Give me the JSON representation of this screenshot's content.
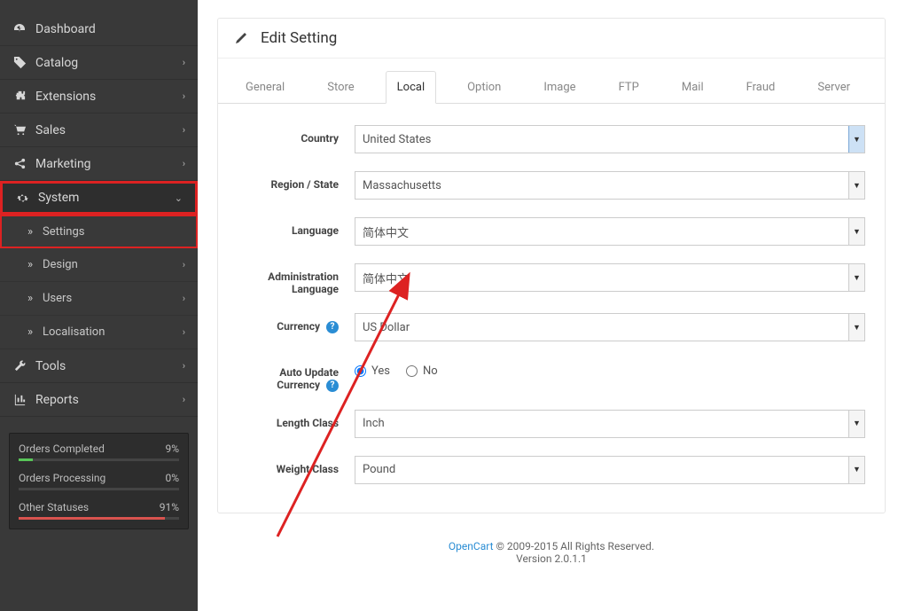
{
  "sidebar": {
    "items": [
      {
        "icon": "dashboard",
        "label": "Dashboard",
        "expandable": false
      },
      {
        "icon": "tag",
        "label": "Catalog",
        "expandable": true
      },
      {
        "icon": "puzzle",
        "label": "Extensions",
        "expandable": true
      },
      {
        "icon": "cart",
        "label": "Sales",
        "expandable": true
      },
      {
        "icon": "share",
        "label": "Marketing",
        "expandable": true
      },
      {
        "icon": "gear",
        "label": "System",
        "expandable": true,
        "expanded": true,
        "highlighted": true,
        "children": [
          {
            "label": "Settings",
            "expandable": false,
            "highlighted": true
          },
          {
            "label": "Design",
            "expandable": true
          },
          {
            "label": "Users",
            "expandable": true
          },
          {
            "label": "Localisation",
            "expandable": true
          }
        ]
      },
      {
        "icon": "wrench",
        "label": "Tools",
        "expandable": true
      },
      {
        "icon": "chart",
        "label": "Reports",
        "expandable": true
      }
    ]
  },
  "stats": [
    {
      "label": "Orders Completed",
      "value_text": "9%",
      "pct": 9,
      "color": "green"
    },
    {
      "label": "Orders Processing",
      "value_text": "0%",
      "pct": 0,
      "color": "grey"
    },
    {
      "label": "Other Statuses",
      "value_text": "91%",
      "pct": 91,
      "color": "red"
    }
  ],
  "panel": {
    "title": "Edit Setting"
  },
  "tabs": [
    {
      "label": "General"
    },
    {
      "label": "Store"
    },
    {
      "label": "Local",
      "active": true
    },
    {
      "label": "Option"
    },
    {
      "label": "Image"
    },
    {
      "label": "FTP"
    },
    {
      "label": "Mail"
    },
    {
      "label": "Fraud"
    },
    {
      "label": "Server"
    }
  ],
  "form": {
    "country": {
      "label": "Country",
      "value": "United States"
    },
    "region": {
      "label": "Region / State",
      "value": "Massachusetts"
    },
    "language": {
      "label": "Language",
      "value": "简体中文"
    },
    "admin_language": {
      "label": "Administration Language",
      "value": "简体中文"
    },
    "currency": {
      "label": "Currency",
      "value": "US Dollar",
      "help": true
    },
    "auto_update_currency": {
      "label": "Auto Update Currency",
      "help": true,
      "yes": "Yes",
      "no": "No",
      "selected": "yes"
    },
    "length_class": {
      "label": "Length Class",
      "value": "Inch"
    },
    "weight_class": {
      "label": "Weight Class",
      "value": "Pound"
    }
  },
  "footer": {
    "link_text": "OpenCart",
    "copyright": " © 2009-2015 All Rights Reserved.",
    "version": "Version 2.0.1.1"
  }
}
